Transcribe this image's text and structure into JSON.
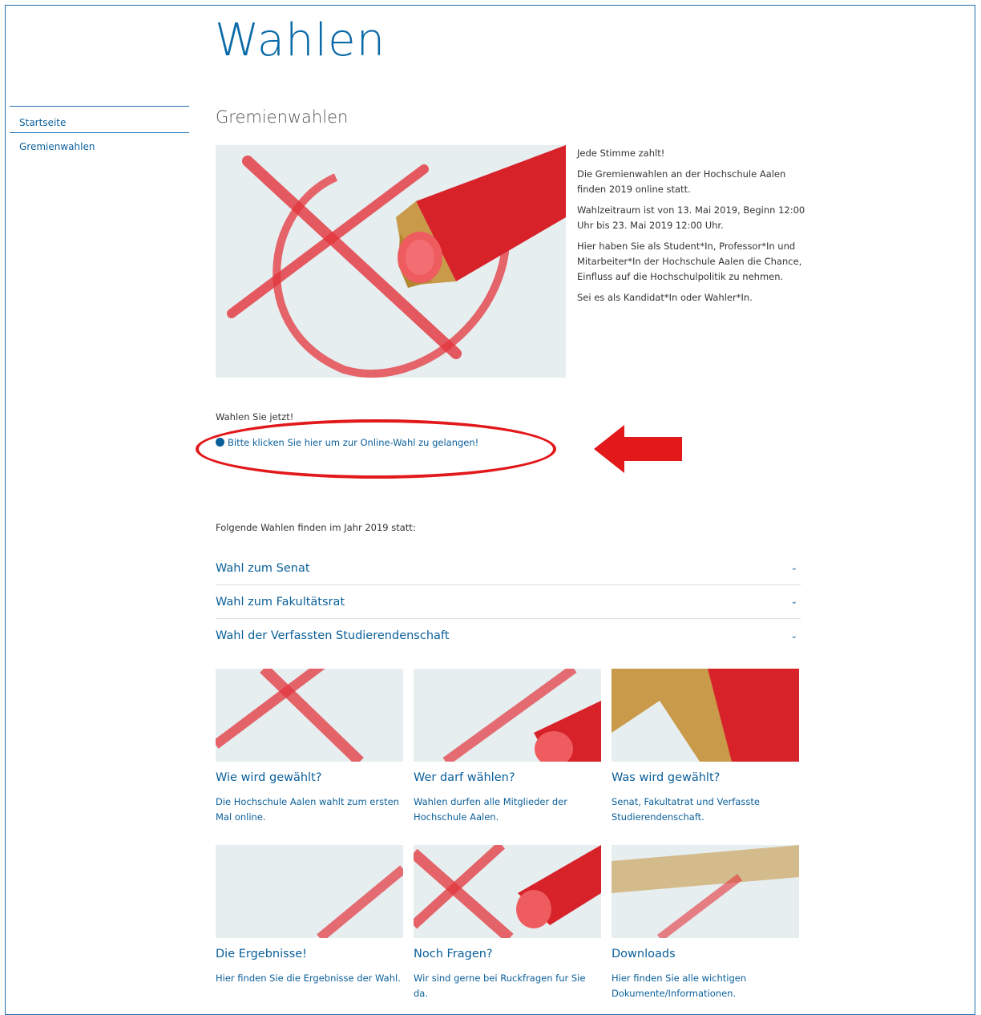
{
  "page": {
    "title": "Wahlen",
    "section_title": "Gremienwahlen"
  },
  "sidebar": {
    "items": [
      {
        "label": "Startseite"
      },
      {
        "label": "Gremienwahlen"
      }
    ]
  },
  "intro": {
    "paragraphs": [
      "Jede Stimme zahlt!",
      "Die Gremienwahlen an der Hochschule Aalen finden 2019 online statt.",
      "Wahlzeitraum ist von 13. Mai 2019, Beginn 12:00 Uhr bis 23. Mai 2019 12:00 Uhr.",
      "Hier haben Sie als Student*In, Professor*In und Mitarbeiter*In der Hochschule Aalen die Chance, Einfluss auf die Hochschulpolitik zu nehmen.",
      "Sei es als Kandidat*In oder Wahler*In."
    ]
  },
  "vote": {
    "label": "Wahlen Sie jetzt!",
    "link_text": "Bitte klicken Sie hier um zur Online-Wahl zu gelangen!",
    "icon": "globe-icon"
  },
  "elections": {
    "intro": "Folgende Wahlen finden im Jahr 2019 statt:",
    "items": [
      {
        "label": "Wahl zum Senat"
      },
      {
        "label": "Wahl zum Fakultätsrat"
      },
      {
        "label": "Wahl der Verfassten Studierendenschaft"
      }
    ]
  },
  "cards": [
    {
      "title": "Wie wird gewählt?",
      "desc": "Die Hochschule Aalen wahlt zum ersten Mal online."
    },
    {
      "title": "Wer darf wählen?",
      "desc": "Wahlen durfen alle Mitglieder der Hochschule Aalen."
    },
    {
      "title": "Was wird gewählt?",
      "desc": "Senat, Fakultatrat und Verfasste Studierendenschaft."
    },
    {
      "title": "Die Ergebnisse!",
      "desc": "Hier finden Sie die Ergebnisse der Wahl."
    },
    {
      "title": "Noch Fragen?",
      "desc": "Wir sind gerne bei Ruckfragen fur Sie da."
    },
    {
      "title": "Downloads",
      "desc": "Hier finden Sie alle wichtigen Dokumente/Informationen."
    }
  ],
  "colors": {
    "accent": "#0a5f9a",
    "annotation_red": "#e2181b",
    "pencil_red": "#d8222a",
    "pencil_wood": "#c89a4a"
  }
}
